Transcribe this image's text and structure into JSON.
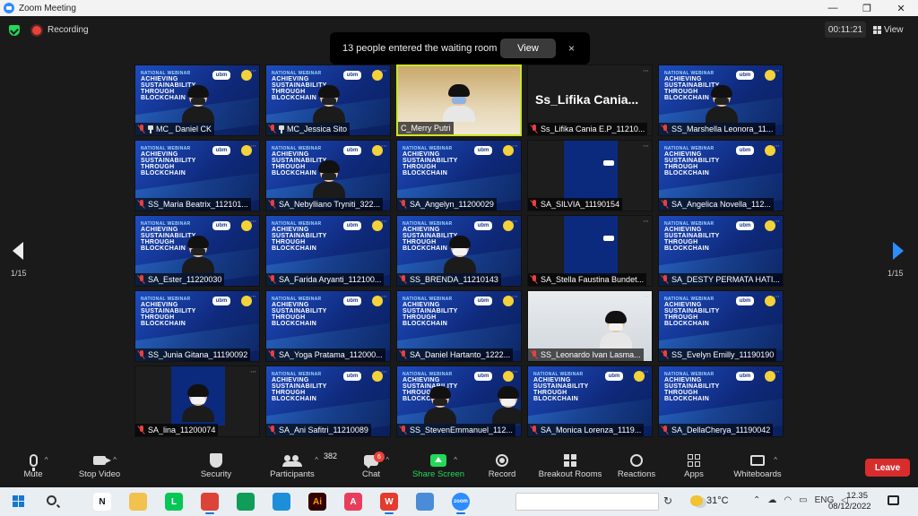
{
  "window": {
    "title": "Zoom Meeting"
  },
  "meeting": {
    "recording_label": "Recording",
    "timer": "00:11:21",
    "view_label": "View"
  },
  "notification": {
    "message": "13 people entered the waiting room",
    "view_button": "View",
    "close_glyph": "×"
  },
  "banner": {
    "line1": "NATIONAL WEBINAR",
    "line2": "ACHIEVING",
    "line3": "SUSTAINABILITY",
    "line4": "THROUGH",
    "line5": "BLOCKCHAIN",
    "logo": "ubm"
  },
  "pager": {
    "left": "1/15",
    "right": "1/15"
  },
  "participants": [
    {
      "name": "MC_ Daniel CK",
      "pinned": true,
      "kind": "banner-person",
      "muted": true
    },
    {
      "name": "MC_Jessica Sito",
      "pinned": true,
      "kind": "banner-person",
      "muted": true
    },
    {
      "name": "C_Merry Putri",
      "pinned": false,
      "kind": "photo-active",
      "muted": false
    },
    {
      "name": "Ss_Lifika Cania E.P_11210...",
      "pinned": false,
      "kind": "name-only",
      "display_name": "Ss_Lifika Cania...",
      "muted": true
    },
    {
      "name": "SS_Marshella Leonora_11...",
      "pinned": false,
      "kind": "banner-person",
      "muted": true
    },
    {
      "name": "SS_Maria Beatrix_112101...",
      "pinned": false,
      "kind": "banner",
      "muted": true
    },
    {
      "name": "SA_Nebylliano Tryniti_322...",
      "pinned": false,
      "kind": "banner-person",
      "muted": true
    },
    {
      "name": "SA_Angelyn_11200029",
      "pinned": false,
      "kind": "banner",
      "muted": true
    },
    {
      "name": "SA_SILVIA_11190154",
      "pinned": false,
      "kind": "mini-banner",
      "muted": true
    },
    {
      "name": "SA_Angelica Novella_112...",
      "pinned": false,
      "kind": "banner",
      "muted": true
    },
    {
      "name": "SA_Ester_11220030",
      "pinned": false,
      "kind": "banner-person",
      "muted": true
    },
    {
      "name": "SA_Farida Aryanti_112100...",
      "pinned": false,
      "kind": "banner",
      "muted": true
    },
    {
      "name": "SS_BRENDA_11210143",
      "pinned": false,
      "kind": "banner-person",
      "muted": true
    },
    {
      "name": "SA_Stella Faustina Bundet...",
      "pinned": false,
      "kind": "mini-banner",
      "muted": true
    },
    {
      "name": "SA_DESTY PERMATA HATI...",
      "pinned": false,
      "kind": "banner",
      "muted": true
    },
    {
      "name": "SS_Junia Gitana_11190092",
      "pinned": false,
      "kind": "banner",
      "muted": true
    },
    {
      "name": "SA_Yoga Pratama_112000...",
      "pinned": false,
      "kind": "banner",
      "muted": true
    },
    {
      "name": "SA_Daniel Hartanto_1222...",
      "pinned": false,
      "kind": "banner",
      "muted": true
    },
    {
      "name": "SS_Leonardo Ivan Lasma...",
      "pinned": false,
      "kind": "photo-room",
      "muted": true
    },
    {
      "name": "SS_Evelyn Emilly_11190190",
      "pinned": false,
      "kind": "banner",
      "muted": true
    },
    {
      "name": "SA_lina_11200074",
      "pinned": false,
      "kind": "mini-person",
      "muted": true
    },
    {
      "name": "SA_Ani Safitri_11210089",
      "pinned": false,
      "kind": "banner",
      "muted": true
    },
    {
      "name": "SS_StevenEmmanuel_112...",
      "pinned": false,
      "kind": "banner-two",
      "muted": true
    },
    {
      "name": "SA_Monica Lorenza_1119...",
      "pinned": false,
      "kind": "banner",
      "muted": true
    },
    {
      "name": "SA_DellaCherya_11190042",
      "pinned": false,
      "kind": "banner",
      "muted": true
    }
  ],
  "toolbar": {
    "mute": "Mute",
    "stop_video": "Stop Video",
    "security": "Security",
    "participants": "Participants",
    "participants_count": "382",
    "chat": "Chat",
    "chat_badge": "6",
    "share_screen": "Share Screen",
    "record": "Record",
    "breakout_rooms": "Breakout Rooms",
    "reactions": "Reactions",
    "apps": "Apps",
    "whiteboards": "Whiteboards",
    "leave": "Leave"
  },
  "taskbar": {
    "weather": "31°C",
    "lang": "ENG",
    "time": "12.35",
    "date": "08/12/2022",
    "refresh_glyph": "↻",
    "apps": [
      {
        "name": "notion",
        "glyph": "N",
        "color": "#ffffff",
        "fg": "#111111"
      },
      {
        "name": "file-explorer",
        "glyph": "",
        "color": "#f2c14e",
        "fg": "#ffffff"
      },
      {
        "name": "line",
        "glyph": "L",
        "color": "#06c755",
        "fg": "#ffffff"
      },
      {
        "name": "chrome",
        "glyph": "",
        "color": "#db4437",
        "fg": "#ffffff"
      },
      {
        "name": "chrome-2",
        "glyph": "",
        "color": "#0f9d58",
        "fg": "#ffffff"
      },
      {
        "name": "edge",
        "glyph": "",
        "color": "#1c8fd8",
        "fg": "#ffffff"
      },
      {
        "name": "illustrator",
        "glyph": "Ai",
        "color": "#330000",
        "fg": "#ff9a00"
      },
      {
        "name": "anydo",
        "glyph": "A",
        "color": "#e93e5b",
        "fg": "#ffffff"
      },
      {
        "name": "wps",
        "glyph": "W",
        "color": "#e33b2e",
        "fg": "#ffffff"
      },
      {
        "name": "app-blue",
        "glyph": "",
        "color": "#4a8cd8",
        "fg": "#ffffff"
      },
      {
        "name": "zoom",
        "glyph": "zoom",
        "color": "#2d8cff",
        "fg": "#ffffff"
      }
    ]
  }
}
